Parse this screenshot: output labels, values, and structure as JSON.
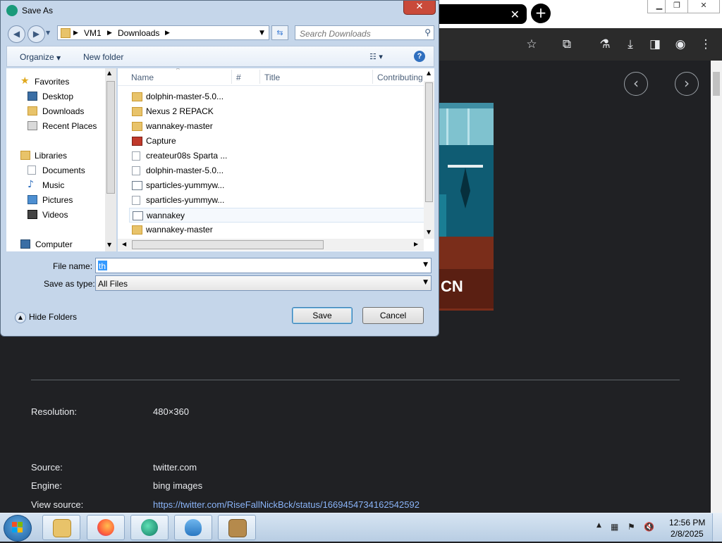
{
  "dialog": {
    "title": "Save As",
    "close_glyph": "✕",
    "breadcrumb": [
      "VM1",
      "Downloads"
    ],
    "search_placeholder": "Search Downloads",
    "organize_label": "Organize",
    "new_folder_label": "New folder",
    "nav": {
      "favorites": "Favorites",
      "desktop": "Desktop",
      "downloads": "Downloads",
      "recent_places": "Recent Places",
      "libraries": "Libraries",
      "documents": "Documents",
      "music": "Music",
      "pictures": "Pictures",
      "videos": "Videos",
      "computer": "Computer"
    },
    "columns": [
      "Name",
      "#",
      "Title",
      "Contributing"
    ],
    "files": [
      {
        "name": "dolphin-master-5.0...",
        "icon": "folder-icon"
      },
      {
        "name": "Nexus 2 REPACK",
        "icon": "folder-icon"
      },
      {
        "name": "wannakey-master",
        "icon": "folder-icon"
      },
      {
        "name": "Capture",
        "icon": "image-file-icon"
      },
      {
        "name": "createur08s Sparta ...",
        "icon": "document-icon"
      },
      {
        "name": "dolphin-master-5.0...",
        "icon": "document-icon"
      },
      {
        "name": "sparticles-yummyw...",
        "icon": "executable-icon"
      },
      {
        "name": "sparticles-yummyw...",
        "icon": "document-icon"
      },
      {
        "name": "wannakey",
        "icon": "executable-icon"
      },
      {
        "name": "wannakey-master",
        "icon": "zip-folder-icon"
      }
    ],
    "selected_file_index": 8,
    "file_name_label": "File name:",
    "file_name_value": "th",
    "save_type_label": "Save as type:",
    "save_type_value": "All Files",
    "hide_folders_label": "Hide Folders",
    "save_label": "Save",
    "cancel_label": "Cancel"
  },
  "page": {
    "resolution_label": "Resolution:",
    "resolution_value": "480×360",
    "source_label": "Source:",
    "source_value": "twitter.com",
    "engine_label": "Engine:",
    "engine_value": "bing images",
    "view_source_label": "View source:",
    "view_source_value": "https://twitter.com/RiseFallNickBck/status/1669454734162542592",
    "preview_logo_text": "CN"
  },
  "taskbar": {
    "time": "12:56 PM",
    "date": "2/8/2025",
    "apps": [
      "file-explorer-icon",
      "firefox-icon",
      "app-icon",
      "dolphin-icon",
      "archive-icon"
    ]
  },
  "colors": {
    "dialog_frame": "#c5d6ea",
    "page_background": "#202124",
    "link": "#8ab4f8",
    "accent_close": "#c94a3a"
  }
}
